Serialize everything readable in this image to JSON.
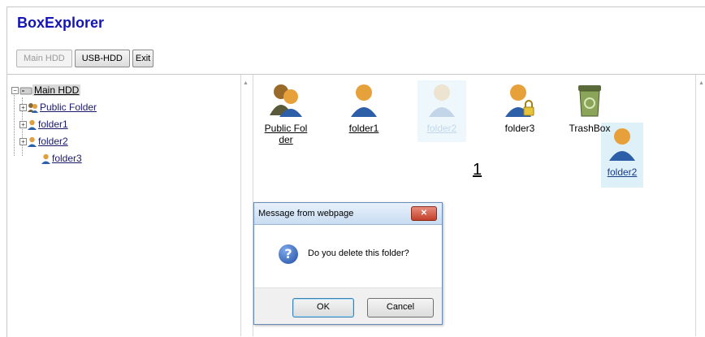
{
  "app": {
    "title": "BoxExplorer"
  },
  "toolbar": {
    "main_hdd": "Main HDD",
    "usb_hdd": "USB-HDD",
    "exit": "Exit"
  },
  "tree": {
    "root": "Main HDD",
    "items": [
      {
        "label": "Public Folder",
        "expandable": true
      },
      {
        "label": "folder1",
        "expandable": true
      },
      {
        "label": "folder2",
        "expandable": true
      },
      {
        "label": "folder3",
        "expandable": false
      }
    ],
    "expander_glyph": "+",
    "root_expander_glyph": "−"
  },
  "grid": {
    "items": [
      {
        "label1": "Public Fol",
        "label2": "der",
        "icon": "group-user-icon"
      },
      {
        "label1": "folder1",
        "icon": "user-folder-icon"
      },
      {
        "label1": "folder2",
        "icon": "user-folder-icon",
        "ghost": true
      },
      {
        "label1": "folder3",
        "icon": "locked-user-folder-icon"
      },
      {
        "label1": "TrashBox",
        "icon": "trash-box-icon"
      }
    ],
    "dragging": {
      "label": "folder2"
    },
    "page_number": "1"
  },
  "dialog": {
    "title": "Message from webpage",
    "close": "✕",
    "message": "Do you delete this folder?",
    "icon_glyph": "?",
    "ok": "OK",
    "cancel": "Cancel"
  },
  "colors": {
    "title": "#1515b5",
    "dialog_border": "#6a8bb5",
    "close_button": "#c2402a"
  }
}
